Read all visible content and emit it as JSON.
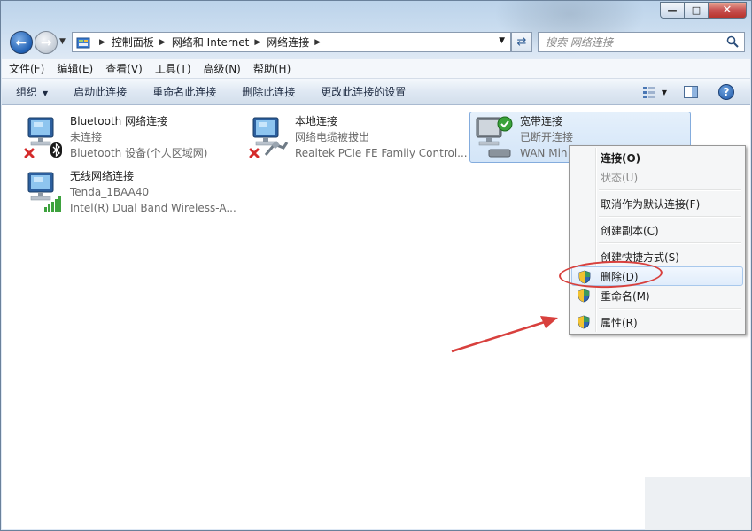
{
  "window": {
    "caption": {
      "minimize": "—",
      "maximize": "□",
      "close": "✕"
    }
  },
  "nav": {
    "breadcrumbs": [
      "控制面板",
      "网络和 Internet",
      "网络连接"
    ],
    "search_placeholder": "搜索 网络连接"
  },
  "menubar": [
    "文件(F)",
    "编辑(E)",
    "查看(V)",
    "工具(T)",
    "高级(N)",
    "帮助(H)"
  ],
  "commands": {
    "organize": "组织",
    "start": "启动此连接",
    "rename": "重命名此连接",
    "delete": "删除此连接",
    "change": "更改此连接的设置"
  },
  "connections": [
    {
      "name": "Bluetooth 网络连接",
      "status": "未连接",
      "device": "Bluetooth 设备(个人区域网)"
    },
    {
      "name": "本地连接",
      "status": "网络电缆被拔出",
      "device": "Realtek PCIe FE Family Control..."
    },
    {
      "name": "宽带连接",
      "status": "已断开连接",
      "device": "WAN Min"
    },
    {
      "name": "无线网络连接",
      "status": "Tenda_1BAA40",
      "device": "Intel(R) Dual Band Wireless-A..."
    }
  ],
  "context_menu": {
    "connect": "连接(O)",
    "status": "状态(U)",
    "cancel_default": "取消作为默认连接(F)",
    "copy": "创建副本(C)",
    "shortcut": "创建快捷方式(S)",
    "delete": "删除(D)",
    "rename": "重命名(M)",
    "properties": "属性(R)"
  },
  "colors": {
    "accent": "#2f66b3",
    "annotation": "#d8403d",
    "selection": "#d3e5f8"
  }
}
